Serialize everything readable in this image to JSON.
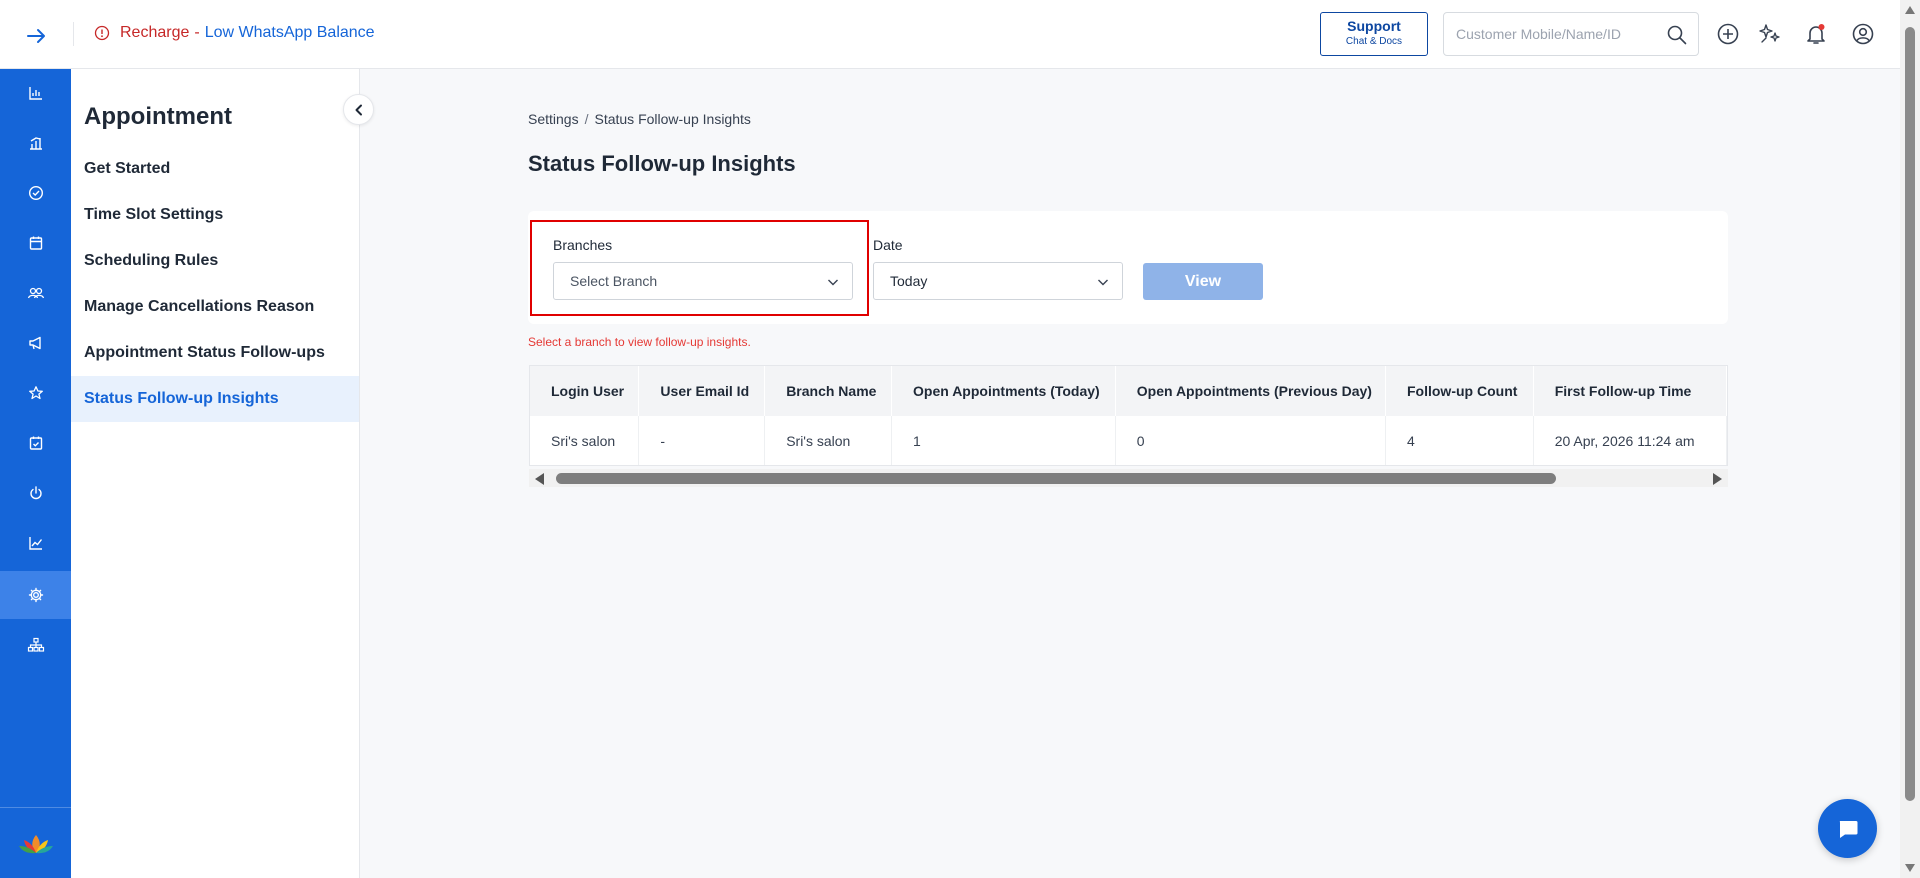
{
  "topbar": {
    "alert": {
      "recharge": "Recharge",
      "separator": "-",
      "balance": "Low WhatsApp Balance"
    },
    "support": {
      "title": "Support",
      "subtitle": "Chat & Docs"
    },
    "search": {
      "placeholder": "Customer Mobile/Name/ID"
    },
    "icons": [
      "expand-arrow-icon",
      "alert-circle-icon",
      "search-icon",
      "add-circle-icon",
      "ai-sparkle-icon",
      "bell-icon",
      "user-profile-icon"
    ],
    "notification_dot_color": "#e53935"
  },
  "rail": {
    "icons": [
      "bar-chart-icon",
      "analytics-icon",
      "check-circle-icon",
      "calendar-icon",
      "customers-icon",
      "megaphone-icon",
      "star-icon",
      "calendar-check-icon",
      "power-icon",
      "trend-chart-icon",
      "settings-icon",
      "org-tree-icon"
    ],
    "active": "settings-icon",
    "logo": "lotus-logo",
    "color": "#1565d8"
  },
  "sidebar": {
    "title": "Appointment",
    "items": [
      {
        "label": "Get Started"
      },
      {
        "label": "Time Slot Settings"
      },
      {
        "label": "Scheduling Rules"
      },
      {
        "label": "Manage Cancellations Reason"
      },
      {
        "label": "Appointment Status Follow-ups"
      },
      {
        "label": "Status Follow-up Insights"
      }
    ],
    "active_index": 5
  },
  "breadcrumb": {
    "root": "Settings",
    "separator": "/",
    "current": "Status Follow-up Insights"
  },
  "page": {
    "title": "Status Follow-up Insights"
  },
  "filters": {
    "branches": {
      "label": "Branches",
      "value": "Select Branch"
    },
    "date": {
      "label": "Date",
      "value": "Today"
    },
    "view_button": "View",
    "hint": "Select a branch to view follow-up insights."
  },
  "table": {
    "headers": [
      "Login User",
      "User Email Id",
      "Branch Name",
      "Open Appointments (Today)",
      "Open Appointments (Previous Day)",
      "Follow-up Count",
      "First Follow-up Time"
    ],
    "rows": [
      [
        "Sri's salon",
        "-",
        "Sri's salon",
        "1",
        "0",
        "4",
        "20 Apr, 2026 11:24 am"
      ]
    ]
  },
  "colors": {
    "accent": "#1565d8",
    "error": "#e00000",
    "view_button_disabled": "#8fb3e8"
  }
}
